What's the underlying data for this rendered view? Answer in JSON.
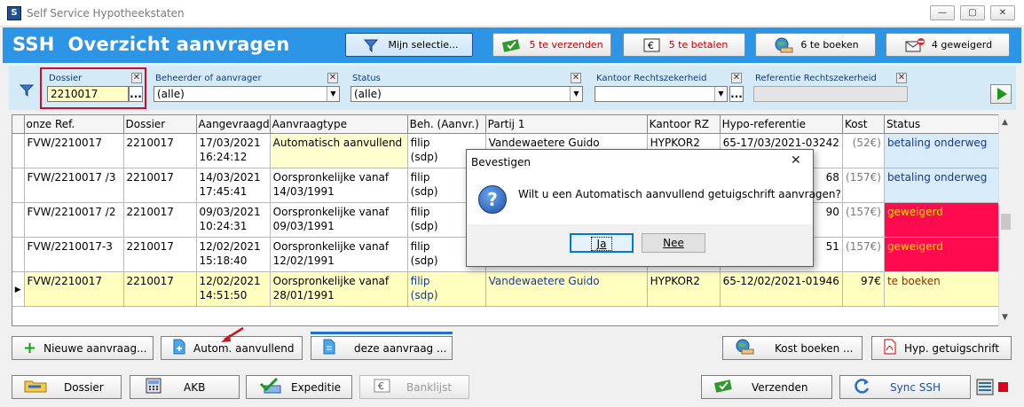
{
  "window": {
    "title": "Self Service Hypotheekstaten"
  },
  "header": {
    "title": "SSH  Overzicht aanvragen",
    "buttons": [
      {
        "label": "Mijn selectie...",
        "icon": "filter-icon"
      },
      {
        "label": "5 te verzenden",
        "icon": "send-check-icon"
      },
      {
        "label": "5 te betalen",
        "icon": "euro-note-icon"
      },
      {
        "label": "6 te boeken",
        "icon": "globe-hand-icon"
      },
      {
        "label": "4 geweigerd",
        "icon": "envelope-minus-icon"
      }
    ]
  },
  "filters": {
    "dossier": {
      "label": "Dossier",
      "value": "2210017",
      "button": "..."
    },
    "beheerder": {
      "label": "Beheerder of aanvrager",
      "value": "(alle)"
    },
    "status": {
      "label": "Status",
      "value": "(alle)"
    },
    "kantoor": {
      "label": "Kantoor Rechtszekerheid",
      "value": "",
      "button": "..."
    },
    "referentie": {
      "label": "Referentie Rechtszekerheid",
      "value": ""
    }
  },
  "table": {
    "columns": [
      "onze Ref.",
      "Dossier",
      "Aangevraagd",
      "Aanvraagtype",
      "Beh. (Aanvr.)",
      "Partij 1",
      "Kantoor RZ",
      "Hypo-referentie",
      "Kost",
      "Status"
    ],
    "rows": [
      {
        "ref": "FVW/2210017",
        "dossier": "2210017",
        "date": "17/03/2021",
        "time": "16:24:12",
        "type1": "Automatisch aanvullend",
        "type2": "",
        "beh1": "filip",
        "beh2": "(sdp)",
        "partij": "Vandewaetere Guido",
        "kantoor": "HYPKOR2",
        "hypo": "65-17/03/2021-03242",
        "kost": "(52€)",
        "status": "betaling onderweg"
      },
      {
        "ref": "FVW/2210017 /3",
        "dossier": "2210017",
        "date": "14/03/2021",
        "time": "17:45:41",
        "type1": "Oorspronkelijke vanaf",
        "type2": "14/03/1991",
        "beh1": "filip",
        "beh2": "(sdp)",
        "partij": "",
        "kantoor": "",
        "hypo": "68",
        "kost": "(157€)",
        "status": "betaling onderweg"
      },
      {
        "ref": "FVW/2210017 /2",
        "dossier": "2210017",
        "date": "09/03/2021",
        "time": "10:24:31",
        "type1": "Oorspronkelijke vanaf",
        "type2": "09/03/1991",
        "beh1": "filip",
        "beh2": "(sdp)",
        "partij": "",
        "kantoor": "",
        "hypo": "90",
        "kost": "(157€)",
        "status": "geweigerd"
      },
      {
        "ref": "FVW/2210017-3",
        "dossier": "2210017",
        "date": "12/02/2021",
        "time": "15:18:40",
        "type1": "Oorspronkelijke vanaf",
        "type2": "12/02/1991",
        "beh1": "filip",
        "beh2": "(sdp)",
        "partij": "",
        "kantoor": "",
        "hypo": "51",
        "kost": "(157€)",
        "status": "geweigerd"
      },
      {
        "ref": "FVW/2210017",
        "dossier": "2210017",
        "date": "12/02/2021",
        "time": "14:51:50",
        "type1": "Oorspronkelijke vanaf",
        "type2": "28/01/1991",
        "beh1": "filip",
        "beh2": "(sdp)",
        "partij": "Vandewaetere Guido",
        "kantoor": "HYPKOR2",
        "hypo": "65-12/02/2021-01946",
        "kost": "97€",
        "status": "te boeken"
      }
    ]
  },
  "actions_row1": [
    {
      "label": "Nieuwe aanvraag...",
      "icon": "plus-icon"
    },
    {
      "label": "Autom. aanvullend",
      "icon": "document-plus-icon"
    },
    {
      "label": "deze aanvraag ...",
      "icon": "document-icon"
    },
    {
      "label": "Kost boeken ...",
      "icon": "globe-hand-icon"
    },
    {
      "label": "Hyp. getuigschrift",
      "icon": "pdf-icon"
    }
  ],
  "actions_row2": [
    {
      "label": "Dossier",
      "icon": "folder-icon"
    },
    {
      "label": "AKB",
      "icon": "calculator-icon"
    },
    {
      "label": "Expeditie",
      "icon": "check-tools-icon"
    },
    {
      "label": "Banklijst",
      "icon": "euro-note-icon"
    },
    {
      "label": "Verzenden",
      "icon": "send-check-icon"
    },
    {
      "label": "Sync SSH",
      "icon": "sync-icon"
    }
  ],
  "dialog": {
    "title": "Bevestigen",
    "message": "Wilt u een Automatisch aanvullend getuigschrift aanvragen?",
    "yes": "Ja",
    "no": "Nee",
    "close": "✕",
    "icon": "?"
  },
  "colors": {
    "header": "#2d95e6",
    "refused": "#ff0a4f",
    "to_book": "#f7b784",
    "paid_green": "#a8f08a",
    "highlight": "#ffffd0"
  }
}
